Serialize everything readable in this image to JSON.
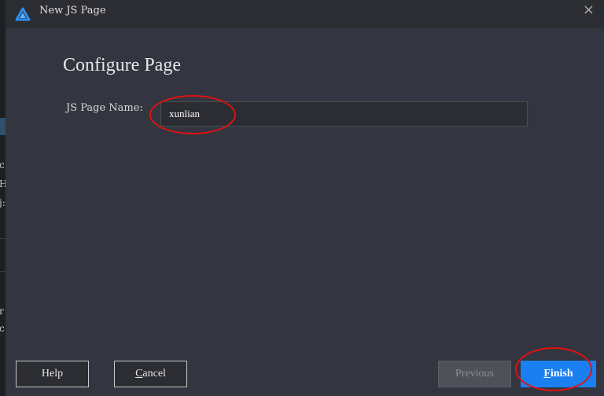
{
  "window": {
    "title": "New JS Page",
    "app_icon": "triangle-logo-icon",
    "close_glyph": "×"
  },
  "background_window": {
    "visible_chars": [
      "c",
      "H",
      "j:",
      "r",
      "c"
    ]
  },
  "main": {
    "heading": "Configure Page",
    "field_label": "JS Page Name:",
    "field_value": "xunlian"
  },
  "footer": {
    "help_label": "Help",
    "cancel_mnemonic": "C",
    "cancel_rest": "ancel",
    "previous_label": "Previous",
    "finish_mnemonic": "F",
    "finish_rest": "inish"
  },
  "colors": {
    "accent": "#1a7ff0",
    "annotation": "#e3110f"
  }
}
